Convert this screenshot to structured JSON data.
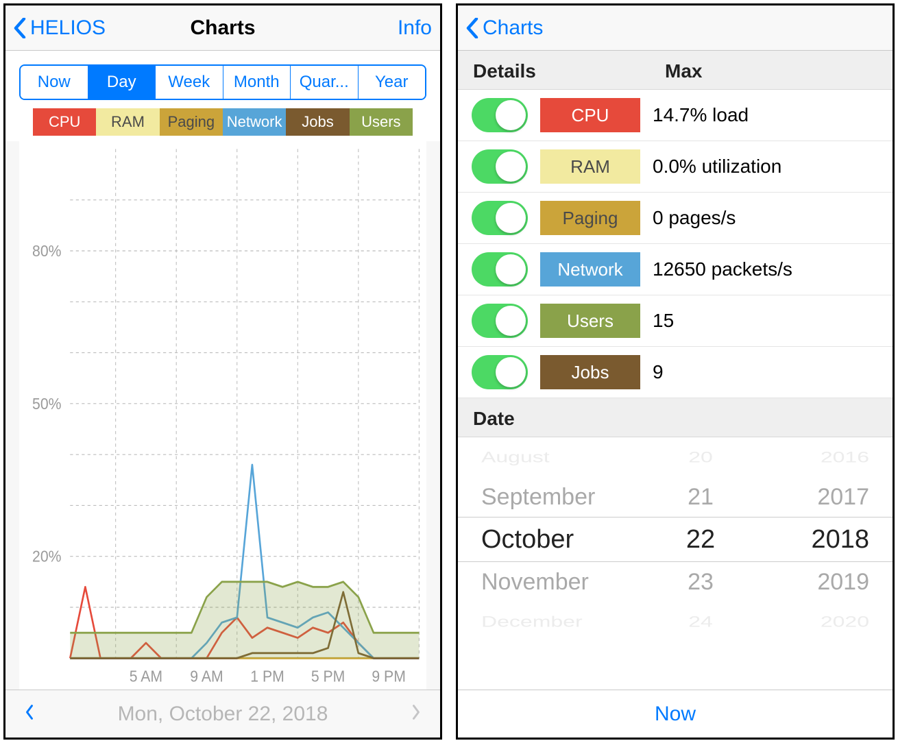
{
  "left": {
    "nav": {
      "back": "HELIOS",
      "title": "Charts",
      "info": "Info"
    },
    "segments": [
      "Now",
      "Day",
      "Week",
      "Month",
      "Quar...",
      "Year"
    ],
    "active_segment": 1,
    "legend": [
      {
        "label": "CPU",
        "bg": "#e64a3b",
        "fg": "#ffffff"
      },
      {
        "label": "RAM",
        "bg": "#f2eaa0",
        "fg": "#4a4a4a"
      },
      {
        "label": "Paging",
        "bg": "#cba43a",
        "fg": "#4a4a4a"
      },
      {
        "label": "Network",
        "bg": "#57a5d8",
        "fg": "#ffffff"
      },
      {
        "label": "Jobs",
        "bg": "#7a5a2f",
        "fg": "#ffffff"
      },
      {
        "label": "Users",
        "bg": "#8aa24a",
        "fg": "#ffffff"
      }
    ],
    "y_ticks": [
      "80%",
      "50%",
      "20%"
    ],
    "x_ticks": [
      "5 AM",
      "9 AM",
      "1 PM",
      "5 PM",
      "9 PM"
    ],
    "footer_date": "Mon, October 22, 2018"
  },
  "right": {
    "nav": {
      "back": "Charts"
    },
    "headers": {
      "details": "Details",
      "max": "Max",
      "date": "Date"
    },
    "rows": [
      {
        "label": "CPU",
        "bg": "#e64a3b",
        "fg": "#ffffff",
        "value": "14.7% load"
      },
      {
        "label": "RAM",
        "bg": "#f2eaa0",
        "fg": "#4a4a4a",
        "value": "0.0% utilization"
      },
      {
        "label": "Paging",
        "bg": "#cba43a",
        "fg": "#4a4a4a",
        "value": "0 pages/s"
      },
      {
        "label": "Network",
        "bg": "#57a5d8",
        "fg": "#ffffff",
        "value": "12650 packets/s"
      },
      {
        "label": "Users",
        "bg": "#8aa24a",
        "fg": "#ffffff",
        "value": "15"
      },
      {
        "label": "Jobs",
        "bg": "#7a5a2f",
        "fg": "#ffffff",
        "value": "9"
      }
    ],
    "picker": {
      "months": [
        "August",
        "September",
        "October",
        "November",
        "December"
      ],
      "days": [
        "20",
        "21",
        "22",
        "23",
        "24"
      ],
      "years": [
        "2016",
        "2017",
        "2018",
        "2019",
        "2020"
      ]
    },
    "footer_now": "Now"
  },
  "chart_data": {
    "type": "line",
    "title": "",
    "xlabel": "",
    "ylabel": "",
    "ylim": [
      0,
      100
    ],
    "x_hours": [
      0,
      1,
      2,
      3,
      4,
      5,
      6,
      7,
      8,
      9,
      10,
      11,
      12,
      13,
      14,
      15,
      16,
      17,
      18,
      19,
      20,
      21,
      22,
      23
    ],
    "series": [
      {
        "name": "CPU",
        "color": "#e64a3b",
        "values": [
          0,
          14,
          0,
          0,
          0,
          3,
          0,
          0,
          0,
          0,
          5,
          8,
          4,
          6,
          5,
          4,
          6,
          5,
          7,
          3,
          0,
          0,
          0,
          0
        ]
      },
      {
        "name": "RAM",
        "color": "#f2eaa0",
        "values": [
          0,
          0,
          0,
          0,
          0,
          0,
          0,
          0,
          0,
          0,
          0,
          0,
          0,
          0,
          0,
          0,
          0,
          0,
          0,
          0,
          0,
          0,
          0,
          0
        ]
      },
      {
        "name": "Paging",
        "color": "#cba43a",
        "values": [
          0,
          0,
          0,
          0,
          0,
          0,
          0,
          0,
          0,
          0,
          0,
          0,
          0,
          0,
          0,
          0,
          0,
          0,
          0,
          0,
          0,
          0,
          0,
          0
        ]
      },
      {
        "name": "Network",
        "color": "#57a5d8",
        "values": [
          0,
          0,
          0,
          0,
          0,
          0,
          0,
          0,
          0,
          3,
          7,
          8,
          38,
          8,
          7,
          6,
          8,
          9,
          6,
          3,
          0,
          0,
          0,
          0
        ]
      },
      {
        "name": "Jobs",
        "color": "#7a5a2f",
        "values": [
          0,
          0,
          0,
          0,
          0,
          0,
          0,
          0,
          0,
          0,
          0,
          0,
          1,
          1,
          1,
          1,
          1,
          2,
          13,
          1,
          0,
          0,
          0,
          0
        ]
      },
      {
        "name": "Users",
        "color": "#8aa24a",
        "fill": "rgba(138,162,74,0.25)",
        "values": [
          5,
          5,
          5,
          5,
          5,
          5,
          5,
          5,
          5,
          12,
          15,
          15,
          15,
          15,
          14,
          15,
          14,
          14,
          15,
          12,
          5,
          5,
          5,
          5
        ]
      }
    ]
  }
}
